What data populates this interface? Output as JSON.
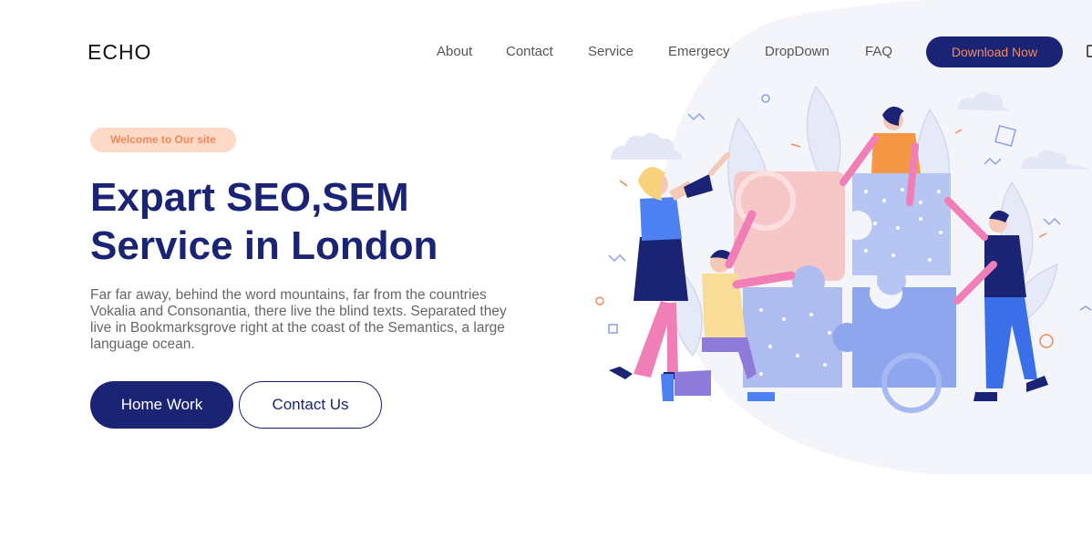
{
  "brand": {
    "logo": "ECHO"
  },
  "nav": {
    "items": [
      "About",
      "Contact",
      "Service",
      "Emergecy",
      "DropDown",
      "FAQ"
    ],
    "cta": "Download Now"
  },
  "hero": {
    "badge": "Welcome to Our site",
    "title_line1": "Expart SEO,SEM",
    "title_line2": "Service in London",
    "description": "Far far away, behind the word mountains, far from the countries Vokalia and Consonantia, there live the blind texts. Separated they live in Bookmarksgrove right at the coast of the Semantics, a large language ocean.",
    "primary_button": "Home Work",
    "secondary_button": "Contact Us"
  },
  "colors": {
    "navy": "#1b2474",
    "accent_orange": "#f48a5a",
    "badge_bg": "#fdd9c7"
  },
  "illustration": {
    "icon": "team-puzzle-illustration"
  }
}
